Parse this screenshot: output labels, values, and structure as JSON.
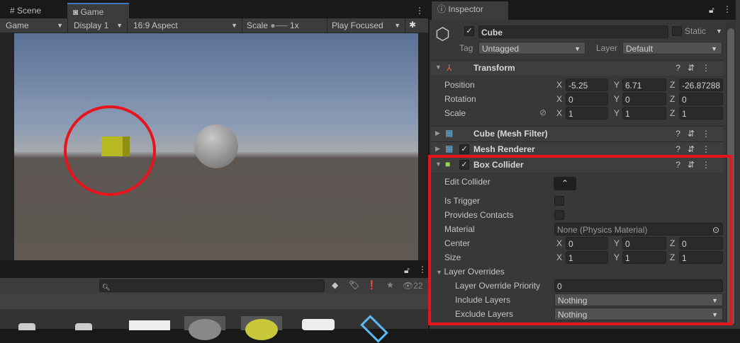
{
  "left_tabs": [
    {
      "label": "Scene",
      "icon": "grid-icon"
    },
    {
      "label": "Game",
      "icon": "gamepad-icon"
    }
  ],
  "game_toolbar": {
    "mode": "Game",
    "display": "Display 1",
    "aspect": "16:9 Aspect",
    "scale_label": "Scale",
    "scale_value": "1x",
    "play_mode": "Play Focused"
  },
  "project": {
    "search_placeholder": "",
    "visible_count": "22"
  },
  "inspector": {
    "tab": "Inspector",
    "object": {
      "name": "Cube",
      "active": true,
      "static_label": "Static",
      "tag_label": "Tag",
      "tag": "Untagged",
      "layer_label": "Layer",
      "layer": "Default"
    },
    "transform": {
      "title": "Transform",
      "rows": [
        {
          "label": "Position",
          "x": "-5.25",
          "y": "6.71",
          "z": "-26.87288"
        },
        {
          "label": "Rotation",
          "x": "0",
          "y": "0",
          "z": "0"
        },
        {
          "label": "Scale",
          "x": "1",
          "y": "1",
          "z": "1"
        }
      ]
    },
    "mesh_filter": {
      "title": "Cube (Mesh Filter)"
    },
    "mesh_renderer": {
      "title": "Mesh Renderer"
    },
    "box_collider": {
      "title": "Box Collider",
      "edit_collider": "Edit Collider",
      "is_trigger": "Is Trigger",
      "provides_contacts": "Provides Contacts",
      "material_label": "Material",
      "material": "None (Physics Material)",
      "center": {
        "label": "Center",
        "x": "0",
        "y": "0",
        "z": "0"
      },
      "size": {
        "label": "Size",
        "x": "1",
        "y": "1",
        "z": "1"
      },
      "layer_overrides": "Layer Overrides",
      "priority_label": "Layer Override Priority",
      "priority": "0",
      "include_label": "Include Layers",
      "include": "Nothing",
      "exclude_label": "Exclude Layers",
      "exclude": "Nothing"
    },
    "axes": {
      "x": "X",
      "y": "Y",
      "z": "Z"
    }
  },
  "colors": {
    "highlight": "#e8141c",
    "accent": "#3a79bb"
  }
}
